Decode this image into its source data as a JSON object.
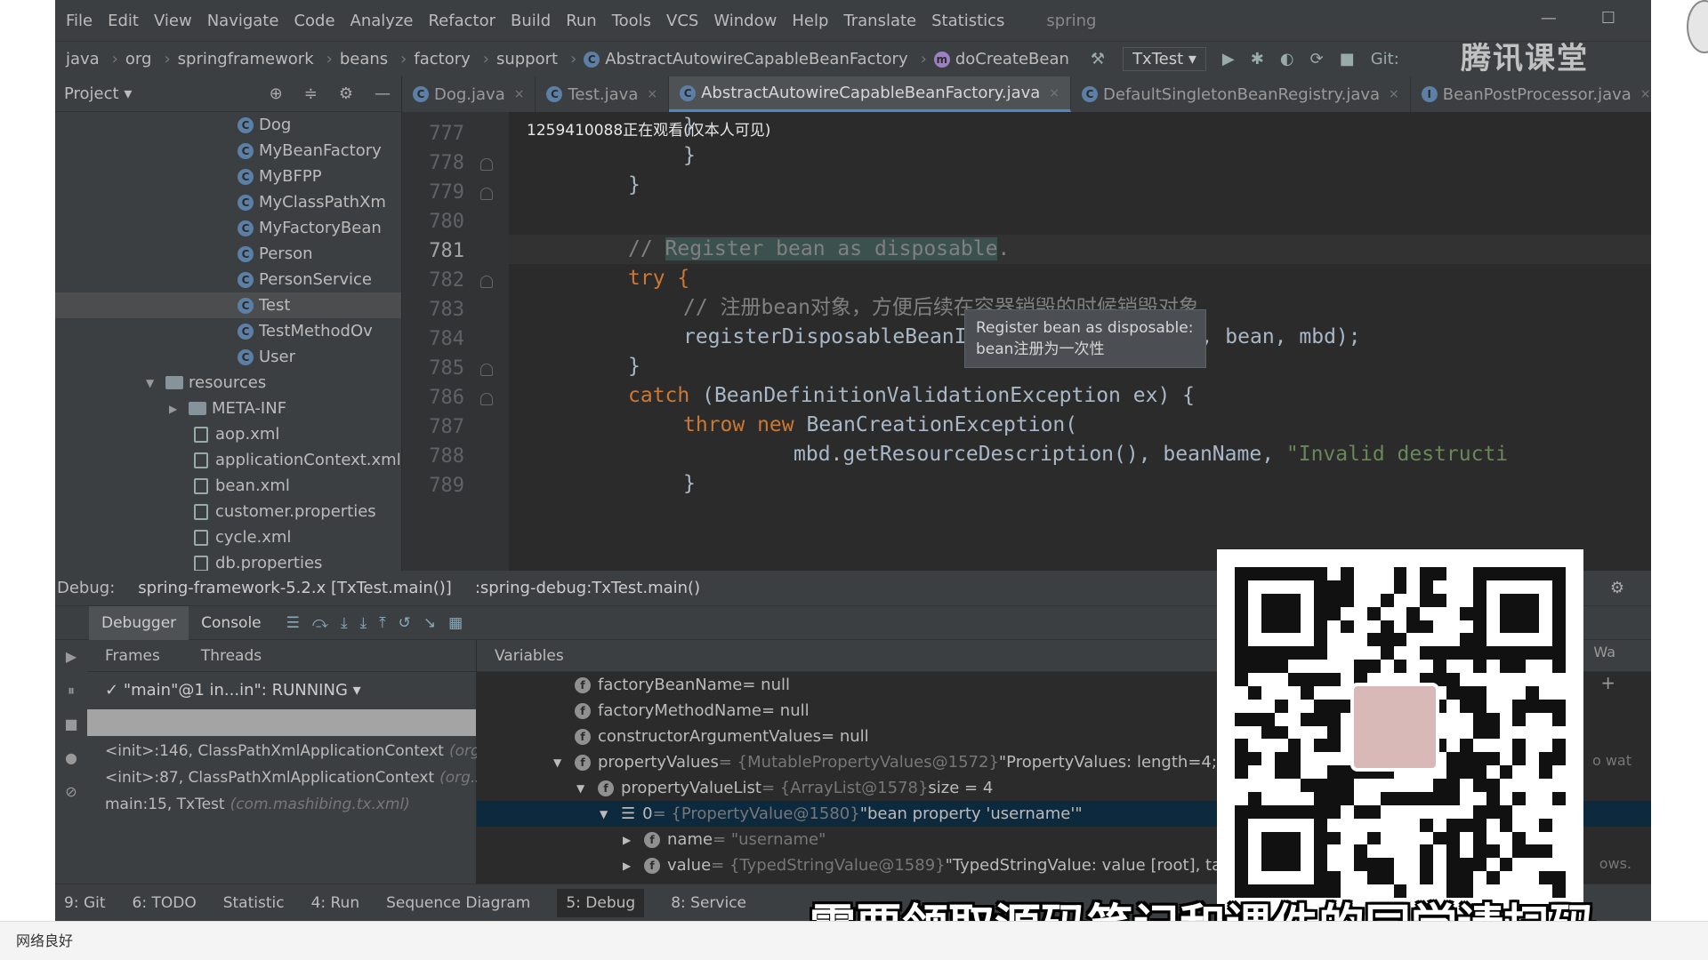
{
  "menu": {
    "items": [
      "File",
      "Edit",
      "View",
      "Navigate",
      "Code",
      "Analyze",
      "Refactor",
      "Build",
      "Run",
      "Tools",
      "VCS",
      "Window",
      "Help",
      "Translate",
      "Statistics"
    ],
    "project_name": "spring"
  },
  "nav": {
    "crumbs": [
      "java",
      "org",
      "springframework",
      "beans",
      "factory",
      "support"
    ],
    "class_crumb": "AbstractAutowireCapableBeanFactory",
    "method_crumb": "doCreateBean",
    "run_config": "TxTest",
    "git_label": "Git:"
  },
  "watermark": "腾讯课堂",
  "project_panel": {
    "title": "Project",
    "items": [
      {
        "label": "Dog",
        "type": "class"
      },
      {
        "label": "MyBeanFactory",
        "type": "class"
      },
      {
        "label": "MyBFPP",
        "type": "class"
      },
      {
        "label": "MyClassPathXm",
        "type": "class"
      },
      {
        "label": "MyFactoryBean",
        "type": "class"
      },
      {
        "label": "Person",
        "type": "class"
      },
      {
        "label": "PersonService",
        "type": "class"
      },
      {
        "label": "Test",
        "type": "class"
      },
      {
        "label": "TestMethodOv",
        "type": "class"
      },
      {
        "label": "User",
        "type": "class"
      },
      {
        "label": "resources",
        "type": "folder"
      },
      {
        "label": "META-INF",
        "type": "folder"
      },
      {
        "label": "aop.xml",
        "type": "file"
      },
      {
        "label": "applicationContext.xml",
        "type": "file"
      },
      {
        "label": "bean.xml",
        "type": "file"
      },
      {
        "label": "customer.properties",
        "type": "file"
      },
      {
        "label": "cycle.xml",
        "type": "file"
      },
      {
        "label": "db.properties",
        "type": "file"
      }
    ]
  },
  "editor": {
    "tabs": [
      "Dog.java",
      "Test.java",
      "AbstractAutowireCapableBeanFactory.java",
      "DefaultSingletonBeanRegistry.java",
      "BeanPostProcessor.java"
    ],
    "active_tab": "AbstractAutowireCapableBeanFactory.java",
    "live_notice": "1259410088正在观看(仅本人可见)",
    "line_numbers": [
      "777",
      "778",
      "779",
      "780",
      "781",
      "782",
      "783",
      "784",
      "785",
      "786",
      "787",
      "788",
      "789"
    ],
    "code": {
      "l777": "}",
      "l778": "}",
      "l779": "}",
      "l781_slashes": "// ",
      "l781_comment": "Register bean as disposable",
      "l781_end": ".",
      "l782": "try {",
      "l783": "// 注册bean对象，方便后续在容器销毁的时候销毁对象",
      "l784_fn": "registerDisposableBeanIfNecessary",
      "l784_args": "(beanName, bean, mbd);",
      "l785": "}",
      "l786_kw": "catch",
      "l786_rest": " (BeanDefinitionValidationException ex) {",
      "l787_kw": "throw new",
      "l787_rest": " BeanCreationException(",
      "l788_a": "mbd.getResourceDescription(), beanName, ",
      "l788_str": "\"Invalid destructi",
      "l789": "}"
    },
    "tooltip": {
      "line1": "Register bean as disposable:",
      "line2": "bean注册为一次性"
    }
  },
  "debug": {
    "label": "Debug:",
    "sessions": [
      "spring-framework-5.2.x [TxTest.main()]",
      ":spring-debug:TxTest.main()"
    ],
    "tabs": [
      "Debugger",
      "Console"
    ],
    "frames_tab": "Frames",
    "threads_tab": "Threads",
    "variables_tab": "Variables",
    "thread": "\"main\"@1 in...in\": RUNNING",
    "frames": [
      {
        "method": "<init>:146, ClassPathXmlApplicationContext",
        "pkg": "(org"
      },
      {
        "method": "<init>:87, ClassPathXmlApplicationContext",
        "pkg": "(org.s"
      },
      {
        "method": "main:15, TxTest",
        "pkg": "(com.mashibing.tx.xml)"
      }
    ],
    "variables": [
      {
        "name": "factoryBeanName",
        "val": " = null",
        "type": ""
      },
      {
        "name": "factoryMethodName",
        "val": " = null",
        "type": ""
      },
      {
        "name": "constructorArgumentValues",
        "val": " = null",
        "type": ""
      },
      {
        "name": "propertyValues",
        "val": " \"PropertyValues: length=4; b",
        "type": " = {MutablePropertyValues@1572}"
      },
      {
        "name": "propertyValueList",
        "val": " size = 4",
        "type": " = {ArrayList@1578}"
      },
      {
        "name": "0",
        "val": " \"bean property 'username'\"",
        "type": " = {PropertyValue@1580}"
      },
      {
        "name": "name",
        "val": "",
        "type": " = \"username\""
      },
      {
        "name": "value",
        "val": " \"TypedStringValue: value [root], targ",
        "type": " = {TypedStringValue@1589}"
      }
    ],
    "watch_label": "Wa",
    "right_hint": "o wat",
    "right_hint2": "ows."
  },
  "statusbar": {
    "items": [
      "9: Git",
      "6: TODO",
      "Statistic",
      "4: Run",
      "Sequence Diagram",
      "5: Debug",
      "8: Service"
    ]
  },
  "subtitle": "需要领取源码笔记和课件的同学请扫码",
  "bottom_strip": "网络良好"
}
